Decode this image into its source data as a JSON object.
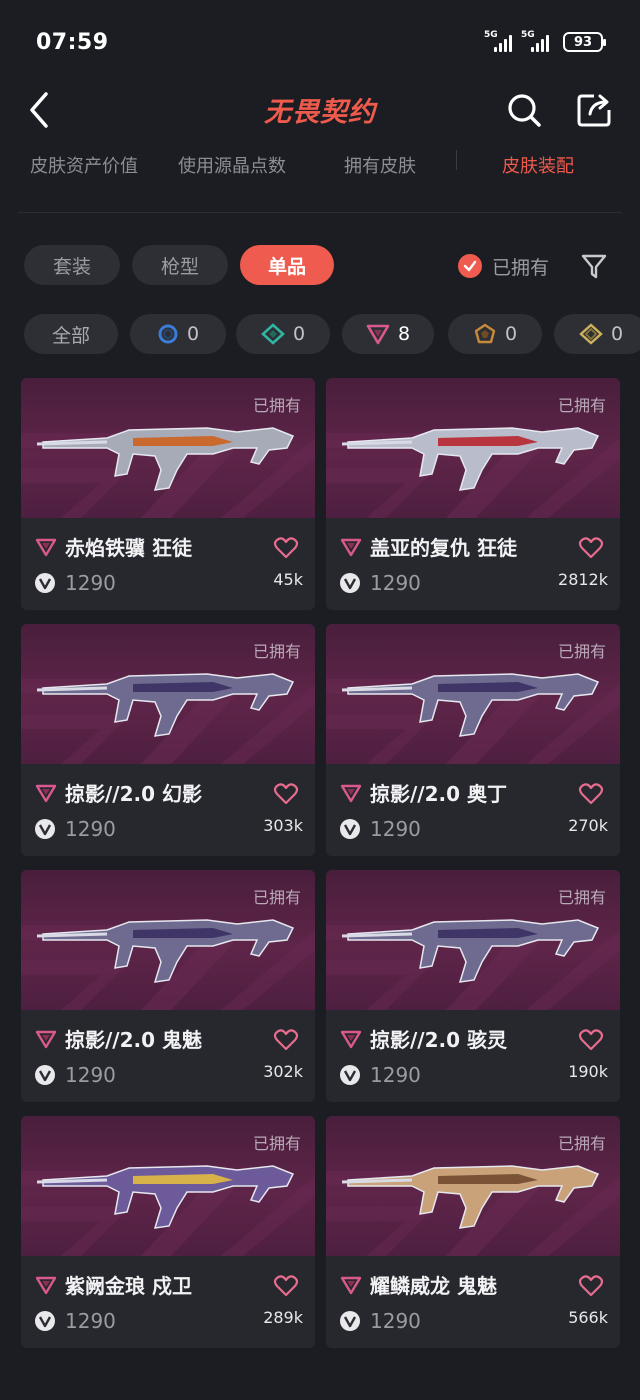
{
  "status_bar": {
    "time": "07:59",
    "signal1": "5G",
    "signal2": "5G",
    "battery": "93"
  },
  "header": {
    "title": "无畏契约",
    "back_icon": "back-arrow-icon",
    "search_icon": "search-icon",
    "share_icon": "share-icon"
  },
  "tabs": [
    {
      "label": "皮肤资产价值"
    },
    {
      "label": "使用源晶点数"
    },
    {
      "label": "拥有皮肤"
    },
    {
      "label": "皮肤装配"
    }
  ],
  "categories": [
    {
      "label": "套装"
    },
    {
      "label": "枪型"
    },
    {
      "label": "单品"
    }
  ],
  "owned_filter": {
    "label": "已拥有"
  },
  "tiers": [
    {
      "label": "全部",
      "count": ""
    },
    {
      "icon": "select-tier-icon",
      "count": "0",
      "color": "#3a7bd5"
    },
    {
      "icon": "deluxe-tier-icon",
      "count": "0",
      "color": "#2fb5a2"
    },
    {
      "icon": "premium-tier-icon",
      "count": "8",
      "color": "#d9598f"
    },
    {
      "icon": "exclusive-tier-icon",
      "count": "0",
      "color": "#e0a84a"
    },
    {
      "icon": "ultra-tier-icon",
      "count": "0",
      "color": "#e3c56a"
    }
  ],
  "cards": [
    {
      "name": "赤焰铁骥 狂徒",
      "price": "1290",
      "likes": "45k",
      "owned": "已拥有"
    },
    {
      "name": "盖亚的复仇 狂徒",
      "price": "1290",
      "likes": "2812k",
      "owned": "已拥有"
    },
    {
      "name": "掠影//2.0 幻影",
      "price": "1290",
      "likes": "303k",
      "owned": "已拥有"
    },
    {
      "name": "掠影//2.0 奥丁",
      "price": "1290",
      "likes": "270k",
      "owned": "已拥有"
    },
    {
      "name": "掠影//2.0 鬼魅",
      "price": "1290",
      "likes": "302k",
      "owned": "已拥有"
    },
    {
      "name": "掠影//2.0 骇灵",
      "price": "1290",
      "likes": "190k",
      "owned": "已拥有"
    },
    {
      "name": "紫阙金琅 戍卫",
      "price": "1290",
      "likes": "289k",
      "owned": "已拥有"
    },
    {
      "name": "耀鳞威龙 鬼魅",
      "price": "1290",
      "likes": "566k",
      "owned": "已拥有"
    }
  ],
  "colors": {
    "accent": "#ef5b4f",
    "background": "#1b1d22",
    "card": "#26282d",
    "premium": "#d9598f"
  }
}
